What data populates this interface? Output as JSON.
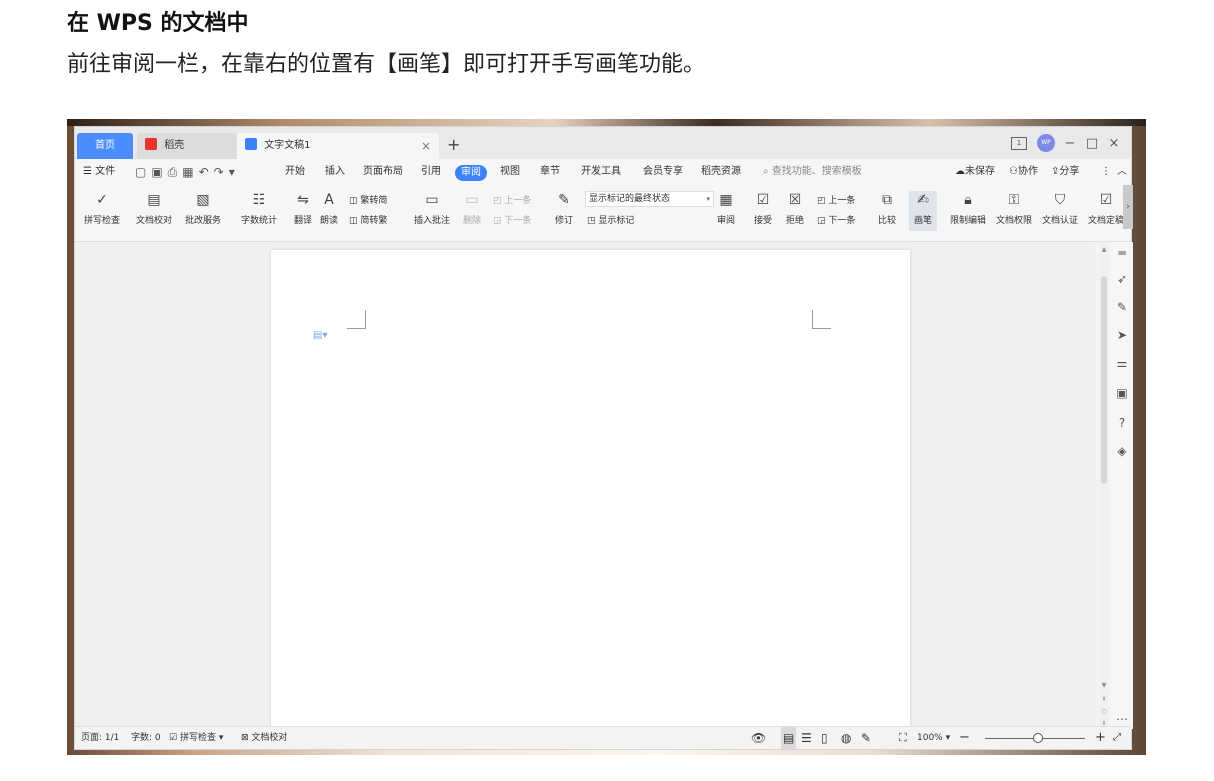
{
  "article": {
    "title": "在 WPS 的文档中",
    "text": "前往审阅一栏，在靠右的位置有【画笔】即可打开手写画笔功能。"
  },
  "titlebar": {
    "tabs": [
      {
        "label": "首页"
      },
      {
        "label": "稻壳"
      },
      {
        "label": "文字文稿1"
      }
    ],
    "new_tab": "+",
    "close_tab": "×",
    "avatar": "WP",
    "box_label": "1",
    "minimize": "−",
    "maximize": "□",
    "close": "×"
  },
  "menubar": {
    "file": "文件",
    "items": [
      "开始",
      "插入",
      "页面布局",
      "引用",
      "审阅",
      "视图",
      "章节",
      "开发工具",
      "会员专享",
      "稻壳资源"
    ],
    "active_index": 4,
    "search": "查找功能、搜索模板",
    "unsaved": "未保存",
    "collab": "协作",
    "share": "分享",
    "more": "⋮",
    "collapse": "︿"
  },
  "ribbon": {
    "spell_check": "拼写检查",
    "doc_proof": "文档校对",
    "revise_service": "批改服务",
    "word_count": "字数统计",
    "translate": "翻译",
    "read_aloud": "朗读",
    "trad": "繁转简",
    "simp": "简转繁",
    "insert_comment": "插入批注",
    "delete": "删除",
    "prev": "上一条",
    "next": "下一条",
    "track": "修订",
    "markup_select": "显示标记的最终状态",
    "show_markup": "显示标记",
    "review": "审阅",
    "accept": "接受",
    "reject": "拒绝",
    "prev2": "上一条",
    "next2": "下一条",
    "compare": "比较",
    "pen": "画笔",
    "restrict_edit": "限制编辑",
    "doc_perm": "文档权限",
    "doc_cert": "文档认证",
    "doc_finalize": "文档定稿",
    "more": "›"
  },
  "statusbar": {
    "page": "页面: 1/1",
    "words": "字数: 0",
    "spell": "拼写检查",
    "proof": "文档校对",
    "zoom": "100%",
    "zoom_out": "−",
    "zoom_in": "+"
  }
}
